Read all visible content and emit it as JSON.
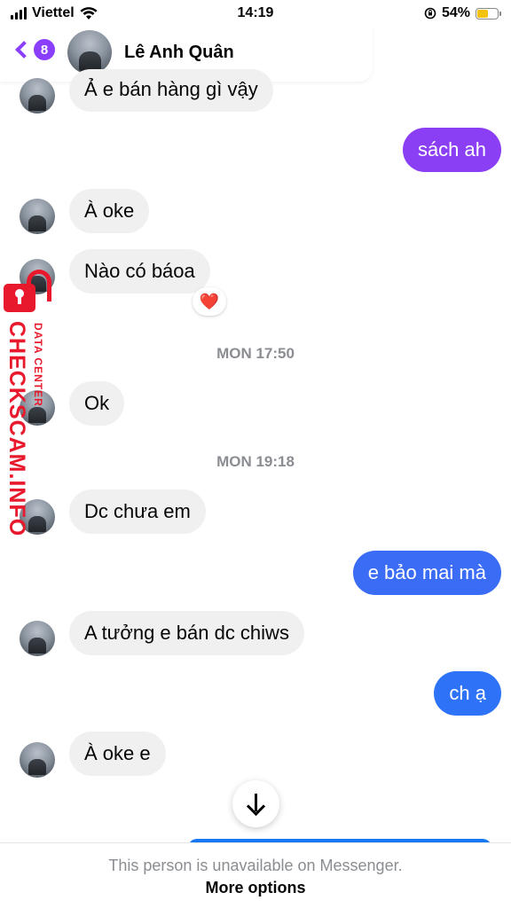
{
  "status_bar": {
    "carrier": "Viettel",
    "time": "14:19",
    "battery_percent": "54%",
    "battery_level": 0.54,
    "battery_color": "#f4c20d",
    "icons": [
      "signal-icon",
      "wifi-icon",
      "orientation-lock-icon",
      "battery-icon"
    ]
  },
  "header": {
    "unread_count": "8",
    "contact_name": "Lê Anh Quân",
    "accent_color": "#8a3ffc"
  },
  "messages": [
    {
      "side": "in",
      "text": "Ả e bán hàng gì vậy"
    },
    {
      "side": "out",
      "text": "sách ah",
      "color": "#8b3ff5"
    },
    {
      "side": "in",
      "text": "À oke"
    },
    {
      "side": "in",
      "text": "Nào có báoa",
      "reaction": "❤️"
    },
    {
      "timestamp": "MON 17:50"
    },
    {
      "side": "in",
      "text": "Ok"
    },
    {
      "timestamp": "MON 19:18"
    },
    {
      "side": "in",
      "text": "Dc chưa em"
    },
    {
      "side": "out",
      "text": "e bảo mai mà",
      "color": "#3b6cf6"
    },
    {
      "side": "in",
      "text": "A tưởng e bán dc chiws"
    },
    {
      "side": "out",
      "text": "ch ạ",
      "color": "#2e73f7"
    },
    {
      "side": "in",
      "text": "À oke e"
    }
  ],
  "watermark": {
    "text": "CHECKSCAM.INFO",
    "subtext": "DATA CENTER",
    "color": "#e8192c"
  },
  "footer": {
    "info": "This person is unavailable on Messenger.",
    "more_options": "More options"
  }
}
